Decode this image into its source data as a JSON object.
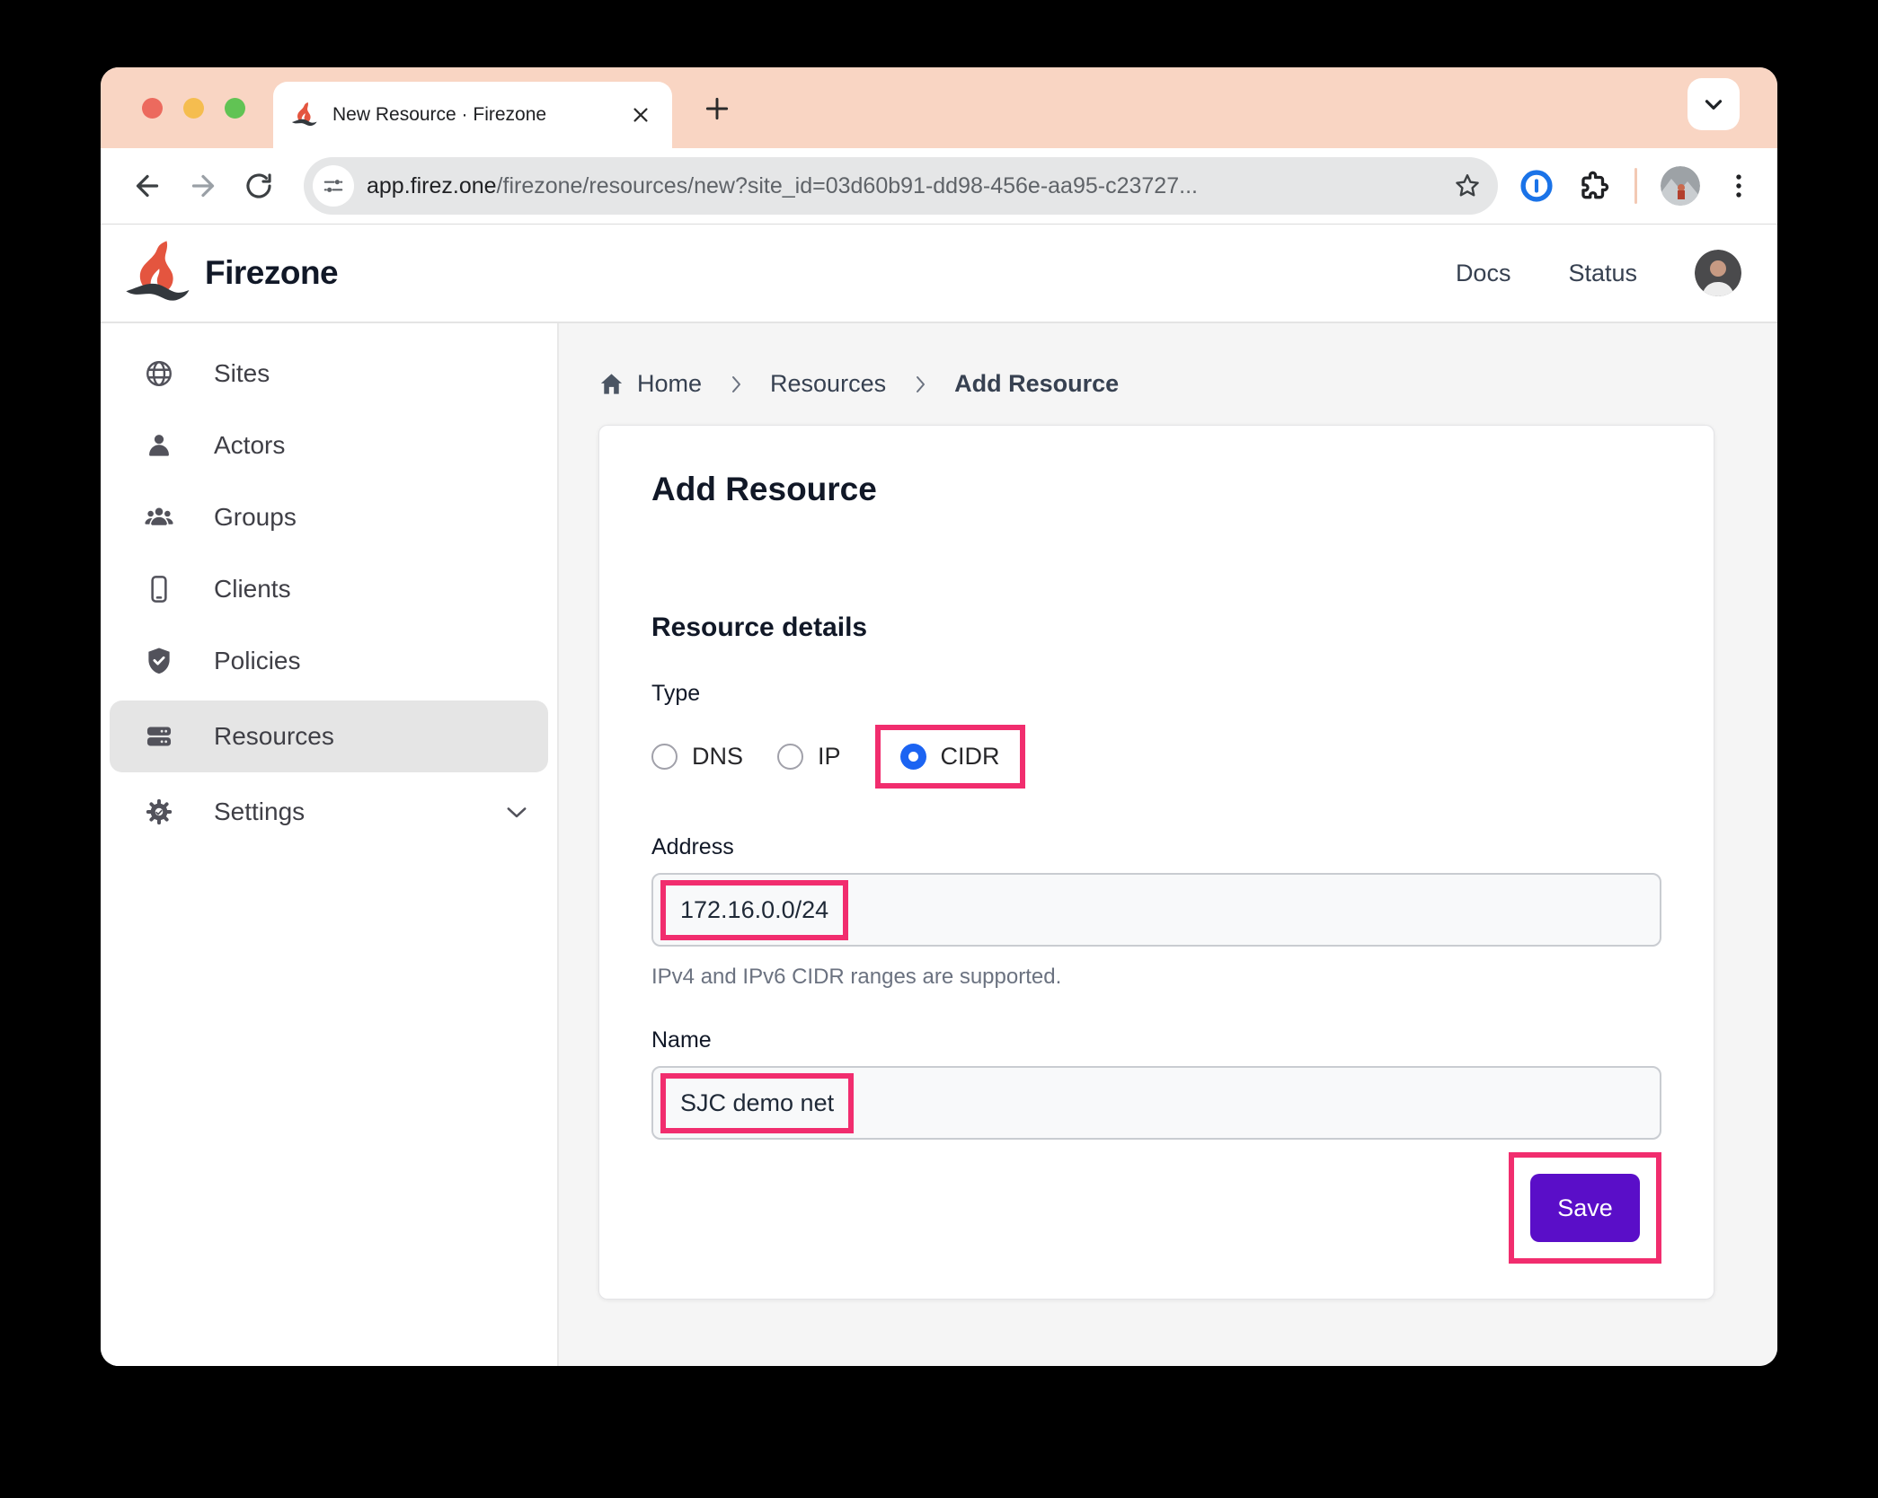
{
  "browser": {
    "tab_title": "New Resource · Firezone",
    "url": {
      "domain": "app.firez.one",
      "path": "/firezone/resources/new?site_id=03d60b91-dd98-456e-aa95-c23727..."
    }
  },
  "header": {
    "brand": "Firezone",
    "links": [
      {
        "label": "Docs"
      },
      {
        "label": "Status"
      }
    ]
  },
  "sidebar": {
    "items": [
      {
        "label": "Sites"
      },
      {
        "label": "Actors"
      },
      {
        "label": "Groups"
      },
      {
        "label": "Clients"
      },
      {
        "label": "Policies"
      },
      {
        "label": "Resources",
        "active": true
      },
      {
        "label": "Settings",
        "expandable": true
      }
    ]
  },
  "breadcrumb": {
    "items": [
      {
        "label": "Home"
      },
      {
        "label": "Resources"
      },
      {
        "label": "Add Resource",
        "current": true
      }
    ]
  },
  "form": {
    "title": "Add Resource",
    "section_title": "Resource details",
    "type_label": "Type",
    "type_options": [
      {
        "label": "DNS",
        "checked": false
      },
      {
        "label": "IP",
        "checked": false
      },
      {
        "label": "CIDR",
        "checked": true,
        "highlighted": true
      }
    ],
    "address_label": "Address",
    "address_value": "172.16.0.0/24",
    "address_help": "IPv4 and IPv6 CIDR ranges are supported.",
    "name_label": "Name",
    "name_value": "SJC demo net",
    "save_label": "Save"
  },
  "colors": {
    "annotation_highlight": "#F12D6E",
    "primary_button": "#5A0EC8",
    "radio_checked": "#1C64F2",
    "tab_strip": "#F9D5C3",
    "sidebar_active_bg": "#E5E5E5",
    "main_bg": "#F5F5F5"
  }
}
